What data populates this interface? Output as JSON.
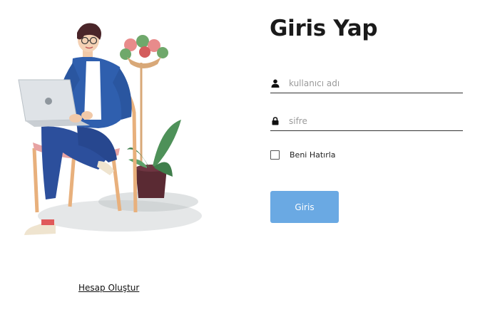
{
  "login": {
    "title": "Giris Yap",
    "username_placeholder": "kullanıcı adı",
    "password_placeholder": "sifre",
    "remember_label": "Beni Hatırla",
    "submit_label": "Giris"
  },
  "footer": {
    "create_account_label": "Hesap Oluştur"
  },
  "icons": {
    "username": "user-icon",
    "password": "lock-icon"
  },
  "colors": {
    "button": "#6aa9e3",
    "jacket": "#2f5fae",
    "text": "#1a1a1a"
  }
}
